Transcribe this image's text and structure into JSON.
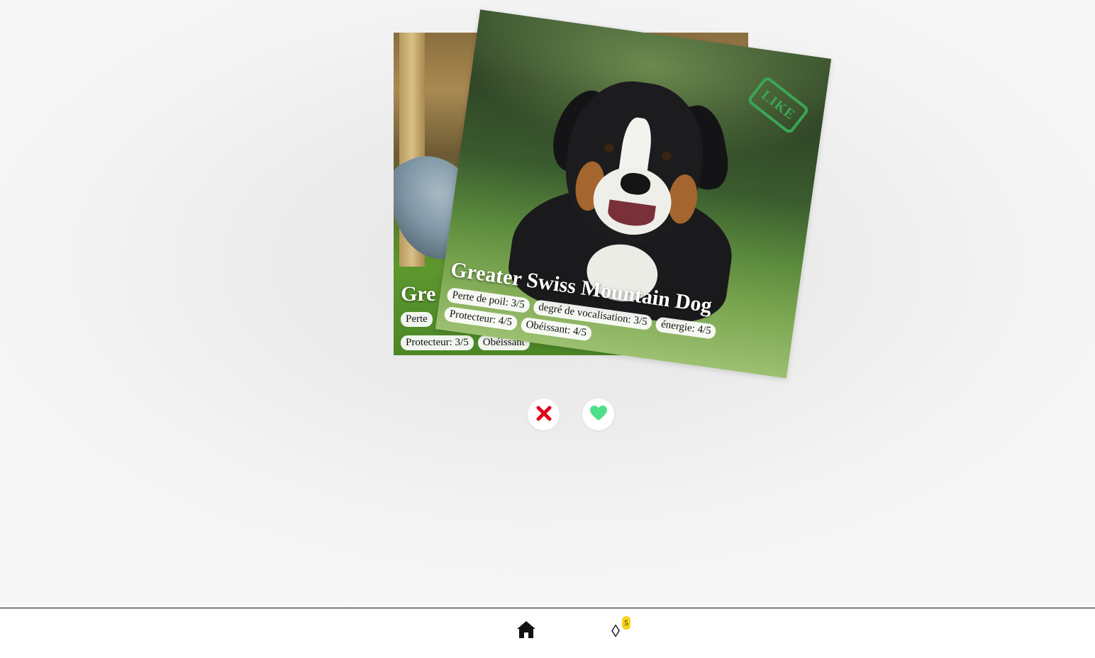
{
  "cards": {
    "back": {
      "title": "Gre",
      "tags_row1": [
        "Perte"
      ],
      "tags_row2": [
        "Protecteur: 3/5",
        "Obéissant"
      ]
    },
    "front": {
      "title": "Greater Swiss Mountain Dog",
      "tags": [
        "Perte de poil: 3/5",
        "degré de vocalisation: 3/5",
        "énergie: 4/5",
        "Protecteur: 4/5",
        "Obéissant: 4/5"
      ],
      "stamp": "LIKE"
    }
  },
  "actions": {
    "dislike_icon": "close-x-icon",
    "like_icon": "heart-icon",
    "dislike_color": "#e0001a",
    "like_color": "#4de08a"
  },
  "nav": {
    "home_icon": "home-icon",
    "matches_icon": "diamond-icon",
    "matches_glyph": "◊",
    "badge_count": "5",
    "badge_color": "#f7d21a"
  }
}
